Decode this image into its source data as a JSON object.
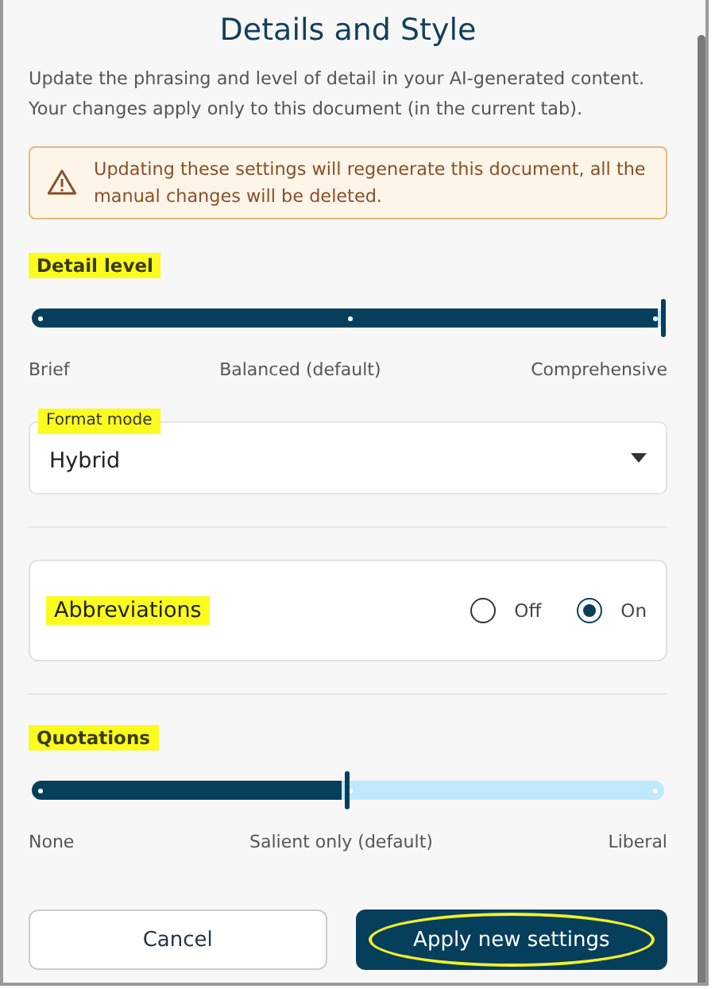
{
  "title": "Details and Style",
  "description": "Update the phrasing and level of detail in your AI-generated content. Your changes apply only to this document (in the current tab).",
  "warning": "Updating these settings will regenerate this document, all the manual changes will be deleted.",
  "detail_level": {
    "label": "Detail level",
    "level": 1,
    "stops": [
      "Brief",
      "Balanced (default)",
      "Comprehensive"
    ]
  },
  "format_mode": {
    "label": "Format mode",
    "value": "Hybrid"
  },
  "abbreviations": {
    "label": "Abbreviations",
    "options": [
      {
        "label": "Off",
        "selected": false
      },
      {
        "label": "On",
        "selected": true
      }
    ]
  },
  "quotations": {
    "label": "Quotations",
    "level": 0.5,
    "stops": [
      "None",
      "Salient only (default)",
      "Liberal"
    ]
  },
  "buttons": [
    {
      "label": "Cancel",
      "kind": "secondary"
    },
    {
      "label": "Apply new settings",
      "kind": "primary"
    }
  ]
}
